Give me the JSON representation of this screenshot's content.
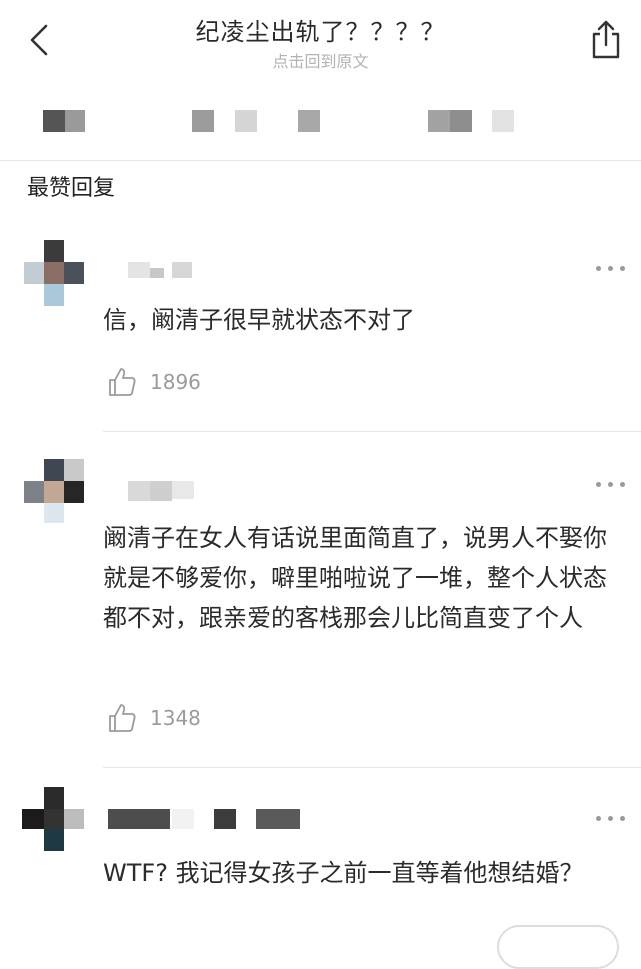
{
  "header": {
    "title": "纪凌尘出轨了？？？？",
    "subtitle": "点击回到原文"
  },
  "section": {
    "title": "最赞回复"
  },
  "comments": [
    {
      "text": "信，阚清子很早就状态不对了",
      "likes": "1896"
    },
    {
      "text": "阚清子在女人有话说里面简直了，说男人不娶你就是不够爱你，噼里啪啦说了一堆，整个人状态都不对，跟亲爱的客栈那会儿比简直变了个人",
      "likes": "1348"
    },
    {
      "text": "WTF? 我记得女孩子之前一直等着他想结婚？",
      "likes": ""
    }
  ],
  "icons": {
    "back": "chevron-left-icon",
    "share": "share-icon",
    "like": "thumbs-up-icon",
    "more": "more-dots-icon"
  },
  "colors": {
    "text": "#2b2b2b",
    "muted": "#9b9b9b",
    "divider": "#e6e6e6"
  }
}
